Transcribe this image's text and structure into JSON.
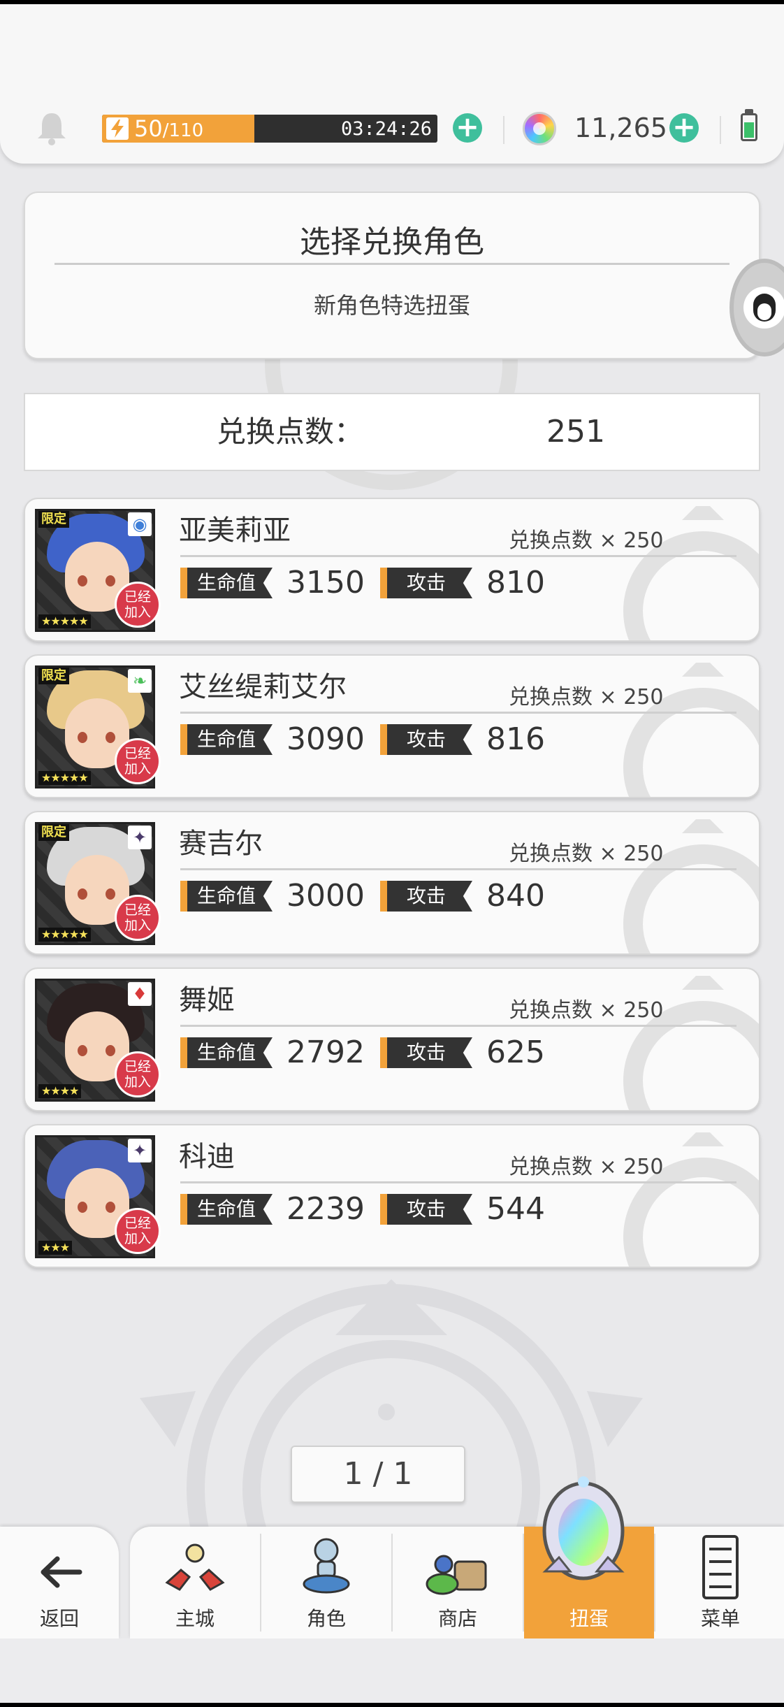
{
  "header": {
    "stamina_current": "50",
    "stamina_max": "/110",
    "stamina_fraction": 0.4545,
    "stamina_timer": "03:24:26",
    "gem_count": "11,265",
    "icons": [
      "bell-icon",
      "bolt-icon",
      "plus-icon",
      "gem-icon",
      "battery-icon"
    ]
  },
  "title_card": {
    "title": "选择兑换角色",
    "subtitle": "新角色特选扭蛋"
  },
  "points": {
    "label": "兑换点数：",
    "value": "251"
  },
  "characters": [
    {
      "name": "亚美莉亚",
      "cost": "兑换点数 × 250",
      "hp_label": "生命值",
      "hp": "3150",
      "atk_label": "攻击",
      "atk": "810",
      "limited": "限定",
      "stars": "★★★★★",
      "badge": "已经加入",
      "attr_icon": "water-circle-icon",
      "hair_color": "#3f63c9"
    },
    {
      "name": "艾丝缇莉艾尔",
      "cost": "兑换点数 × 250",
      "hp_label": "生命值",
      "hp": "3090",
      "atk_label": "攻击",
      "atk": "816",
      "limited": "限定",
      "stars": "★★★★★",
      "badge": "已经加入",
      "attr_icon": "wind-leaf-icon",
      "hair_color": "#e8c98a"
    },
    {
      "name": "赛吉尔",
      "cost": "兑换点数 × 250",
      "hp_label": "生命值",
      "hp": "3000",
      "atk_label": "攻击",
      "atk": "840",
      "limited": "限定",
      "stars": "★★★★★",
      "badge": "已经加入",
      "attr_icon": "dark-star-icon",
      "hair_color": "#d8d8d8"
    },
    {
      "name": "舞姬",
      "cost": "兑换点数 × 250",
      "hp_label": "生命值",
      "hp": "2792",
      "atk_label": "攻击",
      "atk": "625",
      "limited": "",
      "stars": "★★★★",
      "badge": "已经加入",
      "attr_icon": "fire-diamond-icon",
      "hair_color": "#2b2020"
    },
    {
      "name": "科迪",
      "cost": "兑换点数 × 250",
      "hp_label": "生命值",
      "hp": "2239",
      "atk_label": "攻击",
      "atk": "544",
      "limited": "",
      "stars": "★★★",
      "badge": "已经加入",
      "attr_icon": "dark-star-icon",
      "hair_color": "#4b62b8"
    }
  ],
  "pagination": {
    "text": "1 / 1"
  },
  "nav": {
    "back": "返回",
    "items": [
      {
        "label": "主城",
        "icon": "main-city-icon"
      },
      {
        "label": "角色",
        "icon": "character-icon"
      },
      {
        "label": "商店",
        "icon": "shop-icon"
      },
      {
        "label": "扭蛋",
        "icon": "gacha-icon",
        "active": true
      },
      {
        "label": "菜单",
        "icon": "menu-icon"
      }
    ]
  },
  "colors": {
    "accent_orange": "#f2a23a",
    "plus_green": "#3fbf9c",
    "badge_red": "#d83a4a"
  }
}
